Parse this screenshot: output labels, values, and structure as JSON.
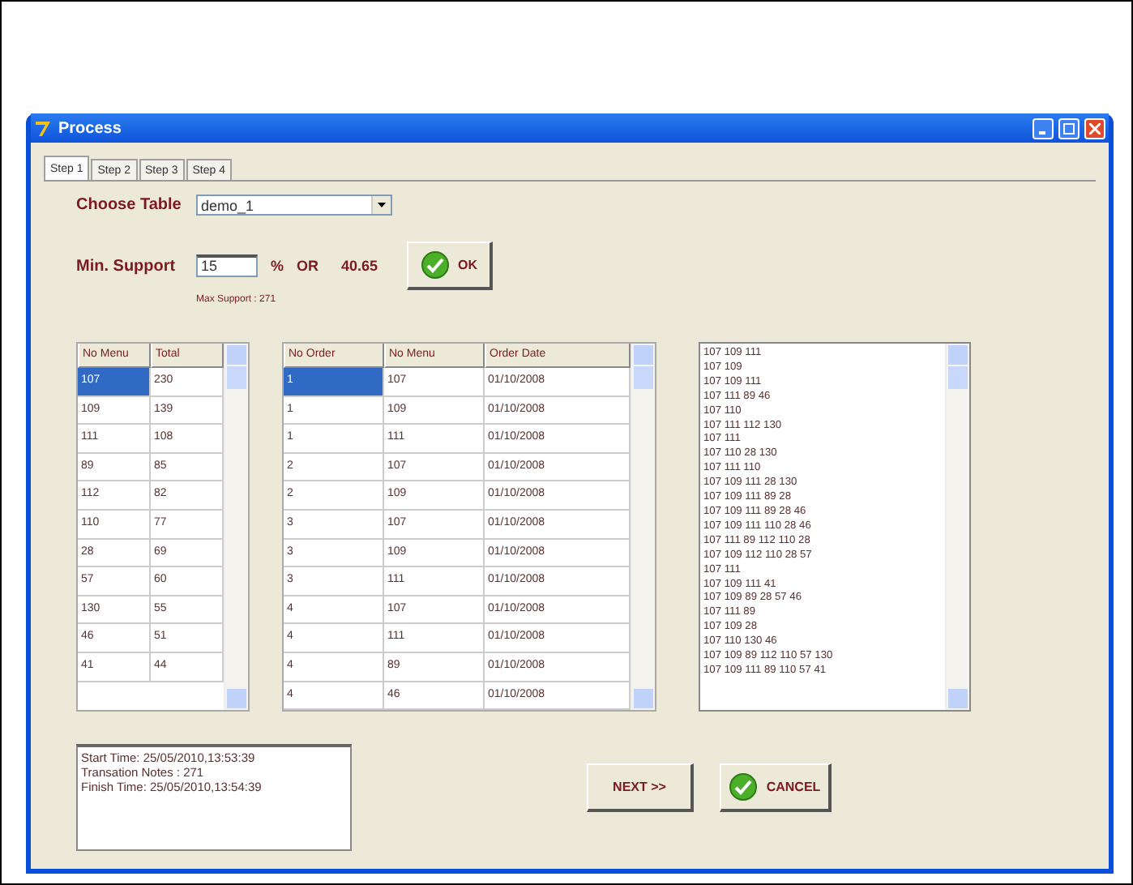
{
  "window": {
    "title": "Process"
  },
  "tabs": [
    {
      "label": "Step 1",
      "selected": true
    },
    {
      "label": "Step 2",
      "selected": false
    },
    {
      "label": "Step 3",
      "selected": false
    },
    {
      "label": "Step 4",
      "selected": false
    }
  ],
  "choose_table": {
    "label": "Choose Table",
    "value": "demo_1"
  },
  "min_support": {
    "label": "Min. Support",
    "value": "15",
    "unit": "%",
    "or": "OR",
    "computed": "40.65",
    "max_support": "Max Support : 271"
  },
  "ok_button": "OK",
  "menu_table": {
    "columns": [
      "No Menu",
      "Total"
    ],
    "rows": [
      {
        "cells": [
          "107",
          "230"
        ],
        "selected": true
      },
      {
        "cells": [
          "109",
          "139"
        ],
        "selected": false
      },
      {
        "cells": [
          "111",
          "108"
        ],
        "selected": false
      },
      {
        "cells": [
          "89",
          "85"
        ],
        "selected": false
      },
      {
        "cells": [
          "112",
          "82"
        ],
        "selected": false
      },
      {
        "cells": [
          "110",
          "77"
        ],
        "selected": false
      },
      {
        "cells": [
          "28",
          "69"
        ],
        "selected": false
      },
      {
        "cells": [
          "57",
          "60"
        ],
        "selected": false
      },
      {
        "cells": [
          "130",
          "55"
        ],
        "selected": false
      },
      {
        "cells": [
          "46",
          "51"
        ],
        "selected": false
      },
      {
        "cells": [
          "41",
          "44"
        ],
        "selected": false
      }
    ]
  },
  "order_table": {
    "columns": [
      "No Order",
      "No Menu",
      "Order Date"
    ],
    "rows": [
      {
        "cells": [
          "1",
          "107",
          "01/10/2008"
        ],
        "selected": true
      },
      {
        "cells": [
          "1",
          "109",
          "01/10/2008"
        ],
        "selected": false
      },
      {
        "cells": [
          "1",
          "111",
          "01/10/2008"
        ],
        "selected": false
      },
      {
        "cells": [
          "2",
          "107",
          "01/10/2008"
        ],
        "selected": false
      },
      {
        "cells": [
          "2",
          "109",
          "01/10/2008"
        ],
        "selected": false
      },
      {
        "cells": [
          "3",
          "107",
          "01/10/2008"
        ],
        "selected": false
      },
      {
        "cells": [
          "3",
          "109",
          "01/10/2008"
        ],
        "selected": false
      },
      {
        "cells": [
          "3",
          "111",
          "01/10/2008"
        ],
        "selected": false
      },
      {
        "cells": [
          "4",
          "107",
          "01/10/2008"
        ],
        "selected": false
      },
      {
        "cells": [
          "4",
          "111",
          "01/10/2008"
        ],
        "selected": false
      },
      {
        "cells": [
          "4",
          "89",
          "01/10/2008"
        ],
        "selected": false
      },
      {
        "cells": [
          "4",
          "46",
          "01/10/2008"
        ],
        "selected": false
      }
    ]
  },
  "itemsets": [
    "107 109 111",
    "107 109",
    "107 109 111",
    "107 111 89 46",
    "107 110",
    "107 111 112 130",
    "107 111",
    "107 110 28 130",
    "107 111 110",
    "107 109 111 28 130",
    "107 109 111 89 28",
    "107 109 111 89 28 46",
    "107 109 111 110 28 46",
    "107 111 89 112 110 28",
    "107 109 112 110 28 57",
    "107 111",
    "107 109 111 41",
    "107 109 89 28 57 46",
    "107 111 89",
    "107 109 28",
    "107 110 130 46",
    "107 109 89 112 110 57 130",
    "107 109 111 89 110 57 41"
  ],
  "log": [
    "Start Time: 25/05/2010,13:53:39",
    "Transation Notes : 271",
    "Finish Time: 25/05/2010,13:54:39"
  ],
  "next_button": "NEXT >>",
  "cancel_button": "CANCEL"
}
